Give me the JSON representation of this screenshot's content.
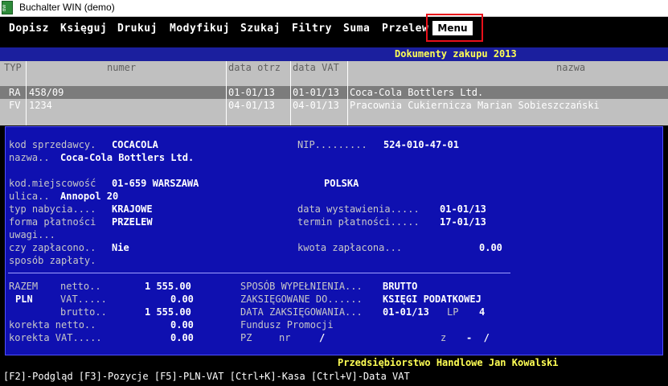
{
  "window": {
    "title": "Buchalter WIN (demo)",
    "icon_name": "buchalter-app-icon"
  },
  "menu": {
    "items": [
      "Dopisz",
      "Księguj",
      "Drukuj",
      "Modyfikuj",
      "Szukaj",
      "Filtry",
      "Suma",
      "Przelew"
    ],
    "active": "Menu"
  },
  "document_list": {
    "title": "Dokumenty zakupu 2013",
    "columns": [
      "TYP",
      "numer",
      "data otrz",
      "data VAT",
      "nazwa"
    ],
    "rows": [
      {
        "typ": "RA",
        "numer": "458/09",
        "data_otrz": "01-01/13",
        "data_vat": "01-01/13",
        "nazwa": "Coca-Cola Bottlers Ltd.",
        "selected": true
      },
      {
        "typ": "FV",
        "numer": "1234",
        "data_otrz": "04-01/13",
        "data_vat": "04-01/13",
        "nazwa": "Pracownia Cukiernicza Marian Sobieszczański",
        "selected": false
      }
    ]
  },
  "details": {
    "kod_sprzedawcy": {
      "label": "kod sprzedawcy.",
      "value": "COCACOLA"
    },
    "nip": {
      "label": "NIP.........",
      "value": "524-010-47-01"
    },
    "nazwa": {
      "label": "nazwa..",
      "value": "Coca-Cola Bottlers Ltd."
    },
    "kod_miejscowosc": {
      "label": "kod.miejscowość",
      "value": "01-659 WARSZAWA"
    },
    "kraj": "POLSKA",
    "ulica": {
      "label": "ulica..",
      "value": "Annopol 20"
    },
    "typ_nabycia": {
      "label": "typ nabycia....",
      "value": "KRAJOWE"
    },
    "data_wystawienia": {
      "label": "data wystawienia.....",
      "value": "01-01/13"
    },
    "forma_platnosci": {
      "label": "forma płatności",
      "value": "PRZELEW"
    },
    "termin_platnosci": {
      "label": "termin płatności.....",
      "value": "17-01/13"
    },
    "uwagi": {
      "label": "uwagi..."
    },
    "czy_zaplacono": {
      "label": "czy zapłacono..",
      "value": "Nie"
    },
    "kwota_zaplacona": {
      "label": "kwota zapłacona...",
      "value": "0.00"
    },
    "sposob_zaplaty": {
      "label": "sposób zapłaty."
    }
  },
  "totals": {
    "razem": "RAZEM",
    "currency": "PLN",
    "netto_label": "netto..",
    "netto_value": "1 555.00",
    "vat_label": "VAT.....",
    "vat_value": "0.00",
    "brutto_label": "brutto..",
    "brutto_value": "1 555.00",
    "korekta_netto_label": "korekta netto..",
    "korekta_netto_value": "0.00",
    "korekta_vat_label": "korekta VAT.....",
    "korekta_vat_value": "0.00",
    "sposob_wypelnienia_label": "SPOSÓB WYPEŁNIENIA...",
    "sposob_wypelnienia_value": "BRUTTO",
    "zaksiegowane_do_label": "ZAKSIĘGOWANE DO......",
    "zaksiegowane_do_value": "KSIĘGI PODATKOWEJ",
    "data_zaksiegowania_label": "DATA ZAKSIĘGOWANIA...",
    "data_zaksiegowania_value": "01-01/13",
    "lp_label": "LP",
    "lp_value": "4",
    "fundusz": "Fundusz Promocji",
    "pz_label": "PZ",
    "nr_label": "nr",
    "nr_value": "/",
    "z_label": "z",
    "z_value": "-  /"
  },
  "footer": {
    "company": "Przedsiębiorstwo Handlowe Jan Kowalski",
    "keys": "[F2]-Podgląd [F3]-Pozycje [F5]-PLN-VAT [Ctrl+K]-Kasa [Ctrl+V]-Data VAT"
  },
  "colors": {
    "panel": "#0f10b0",
    "highlight_box": "#e8101a",
    "title_yellow": "#ffff55"
  }
}
